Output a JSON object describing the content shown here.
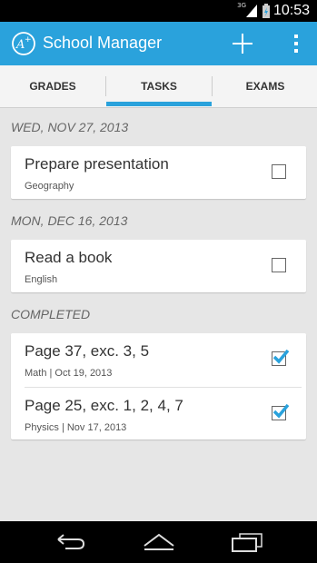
{
  "status": {
    "network": "3G",
    "time": "10:53"
  },
  "app": {
    "title": "School Manager"
  },
  "tabs": [
    {
      "label": "GRADES"
    },
    {
      "label": "TASKS",
      "selected": true
    },
    {
      "label": "EXAMS"
    }
  ],
  "sections": [
    {
      "header": "WED, NOV 27, 2013",
      "items": [
        {
          "title": "Prepare presentation",
          "subtitle": "Geography",
          "checked": false
        }
      ]
    },
    {
      "header": "MON, DEC 16, 2013",
      "items": [
        {
          "title": "Read a book",
          "subtitle": "English",
          "checked": false
        }
      ]
    },
    {
      "header": "COMPLETED",
      "items": [
        {
          "title": "Page 37, exc. 3, 5",
          "subtitle": "Math | Oct 19, 2013",
          "checked": true
        },
        {
          "title": "Page 25, exc. 1, 2, 4, 7",
          "subtitle": "Physics | Nov 17, 2013",
          "checked": true
        }
      ]
    }
  ],
  "colors": {
    "accent": "#2aa2dc",
    "background": "#e6e6e6"
  },
  "icons": [
    "app-logo-icon",
    "add-icon",
    "overflow-menu-icon",
    "back-icon",
    "home-icon",
    "recent-apps-icon"
  ]
}
